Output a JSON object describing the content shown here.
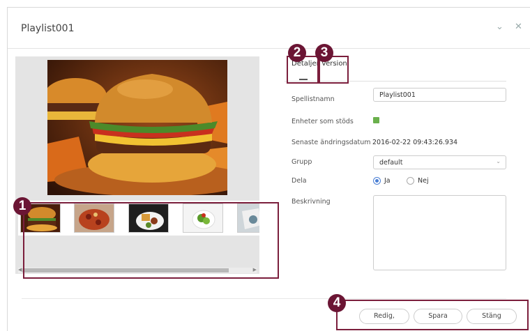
{
  "dialog": {
    "title": "Playlist001",
    "collapse_icon": "chevron-down-icon",
    "close_icon": "close-icon"
  },
  "tabs": [
    {
      "label": "Detaljer",
      "active": true
    },
    {
      "label": "Version",
      "active": false
    }
  ],
  "form": {
    "name_label": "Spellistnamn",
    "name_value": "Playlist001",
    "devices_label": "Enheter som stöds",
    "date_label": "Senaste ändringsdatum",
    "date_value": "2016-02-22 09:43:26.934",
    "group_label": "Grupp",
    "group_value": "default",
    "share_label": "Dela",
    "share_yes": "Ja",
    "share_no": "Nej",
    "share_selected": "Ja",
    "description_label": "Beskrivning",
    "description_value": ""
  },
  "thumbnails": [
    "burger",
    "pizza",
    "fries-plate",
    "salad",
    "partial-image"
  ],
  "annotations": [
    "1",
    "2",
    "3",
    "4"
  ],
  "buttons": {
    "edit": "Redig,",
    "save": "Spara",
    "close": "Stäng"
  },
  "colors": {
    "annotation": "#7b1e3c",
    "badge": "#6b1534",
    "radio_selected": "#4a7fd4",
    "device_indicator": "#6ab04c"
  }
}
